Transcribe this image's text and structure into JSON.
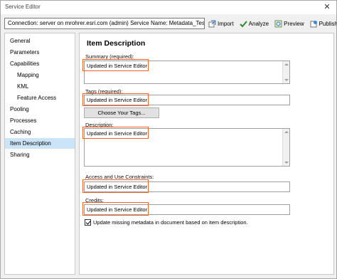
{
  "window": {
    "title": "Service Editor",
    "close_glyph": "✕"
  },
  "connection": {
    "text": "Connection: server on mrohrer.esri.com (admin)   Service Name: Metadata_Test"
  },
  "toolbar": {
    "import_label": "Import",
    "analyze_label": "Analyze",
    "preview_label": "Preview",
    "publish_label": "Publish"
  },
  "sidebar": {
    "items": [
      {
        "label": "General"
      },
      {
        "label": "Parameters"
      },
      {
        "label": "Capabilities"
      },
      {
        "label": "Mapping"
      },
      {
        "label": "KML"
      },
      {
        "label": "Feature Access"
      },
      {
        "label": "Pooling"
      },
      {
        "label": "Processes"
      },
      {
        "label": "Caching"
      },
      {
        "label": "Item Description"
      },
      {
        "label": "Sharing"
      }
    ],
    "selected": "Item Description"
  },
  "panel": {
    "title": "Item Description",
    "summary_label": "Summary (required):",
    "summary_value": "Updated in Service Editor",
    "tags_label": "Tags (required):",
    "tags_value": "Updated in Service Editor",
    "choose_tags_button": "Choose Your Tags...",
    "description_label": "Description:",
    "description_value": "Updated in Service Editor",
    "constraints_label": "Access and Use Constraints:",
    "constraints_value": "Updated in Service Editor",
    "credits_label": "Credits:",
    "credits_value": "Updated in Service Editor",
    "update_metadata_label": "Update missing metadata in document based on item description.",
    "update_metadata_checked": true
  },
  "colors": {
    "highlight": "#f26522",
    "selection": "#cce4f7"
  }
}
